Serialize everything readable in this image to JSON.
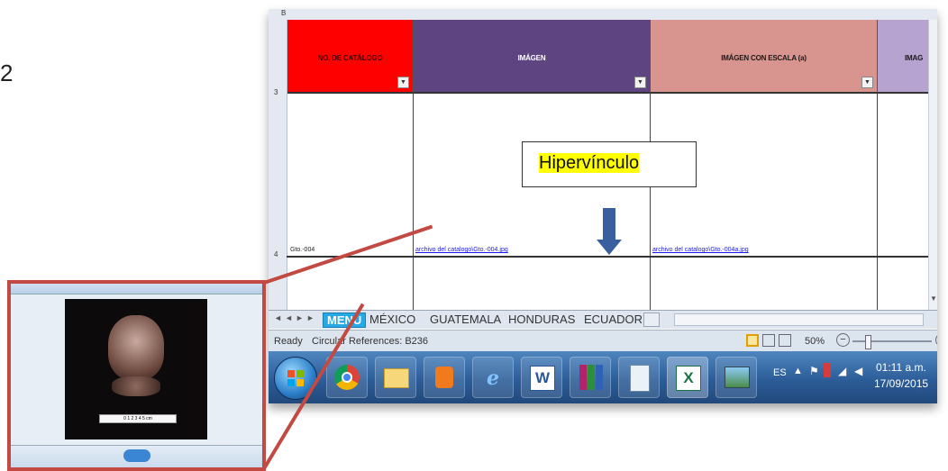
{
  "step_number": "2",
  "spreadsheet": {
    "columns": [
      {
        "label": "NO. DE CATÁLOGO",
        "color": "#ff0000",
        "text_color": "#3a0000"
      },
      {
        "label": "IMÁGEN",
        "color": "#5e4480",
        "text_color": "#ffffff"
      },
      {
        "label": "IMÁGEN CON ESCALA (a)",
        "color": "#d8948f",
        "text_color": "#1a1a1a"
      },
      {
        "label": "IMAG",
        "color": "#b7a3cf",
        "text_color": "#1a1a1a"
      }
    ],
    "row_label": "4",
    "catalog_cell": "Gto.-004",
    "link_image": "archivo del catalogo\\Gto.-004.jpg",
    "link_scaled": "archivo del catalogo\\Gto.-004a.jpg",
    "dropdown_glyph": "▼",
    "scroll_up": "▲",
    "scroll_down": "▼"
  },
  "callout": {
    "text": "Hipervínculo",
    "highlight_color": "#ffff00"
  },
  "sheet_tabs": {
    "nav": [
      "◄",
      "◄",
      "►",
      "►"
    ],
    "tabs": [
      "MENU",
      "MÉXICO",
      "GUATEMALA",
      "HONDURAS",
      "ECUADOR"
    ],
    "active": "MENU"
  },
  "status_bar": {
    "ready": "Ready",
    "circular": "Circular References: B236",
    "zoom": "50%",
    "zoom_minus": "−",
    "zoom_plus": "+"
  },
  "taskbar": {
    "language": "ES",
    "time": "01:11 a.m.",
    "date": "17/09/2015",
    "apps": [
      "start-orb",
      "chrome",
      "explorer",
      "media-player",
      "internet-explorer",
      "word",
      "winrar",
      "notepad",
      "excel",
      "photo-viewer"
    ]
  },
  "photo_viewer": {
    "scale_label": "0 1 2 3 4 5 cm"
  }
}
